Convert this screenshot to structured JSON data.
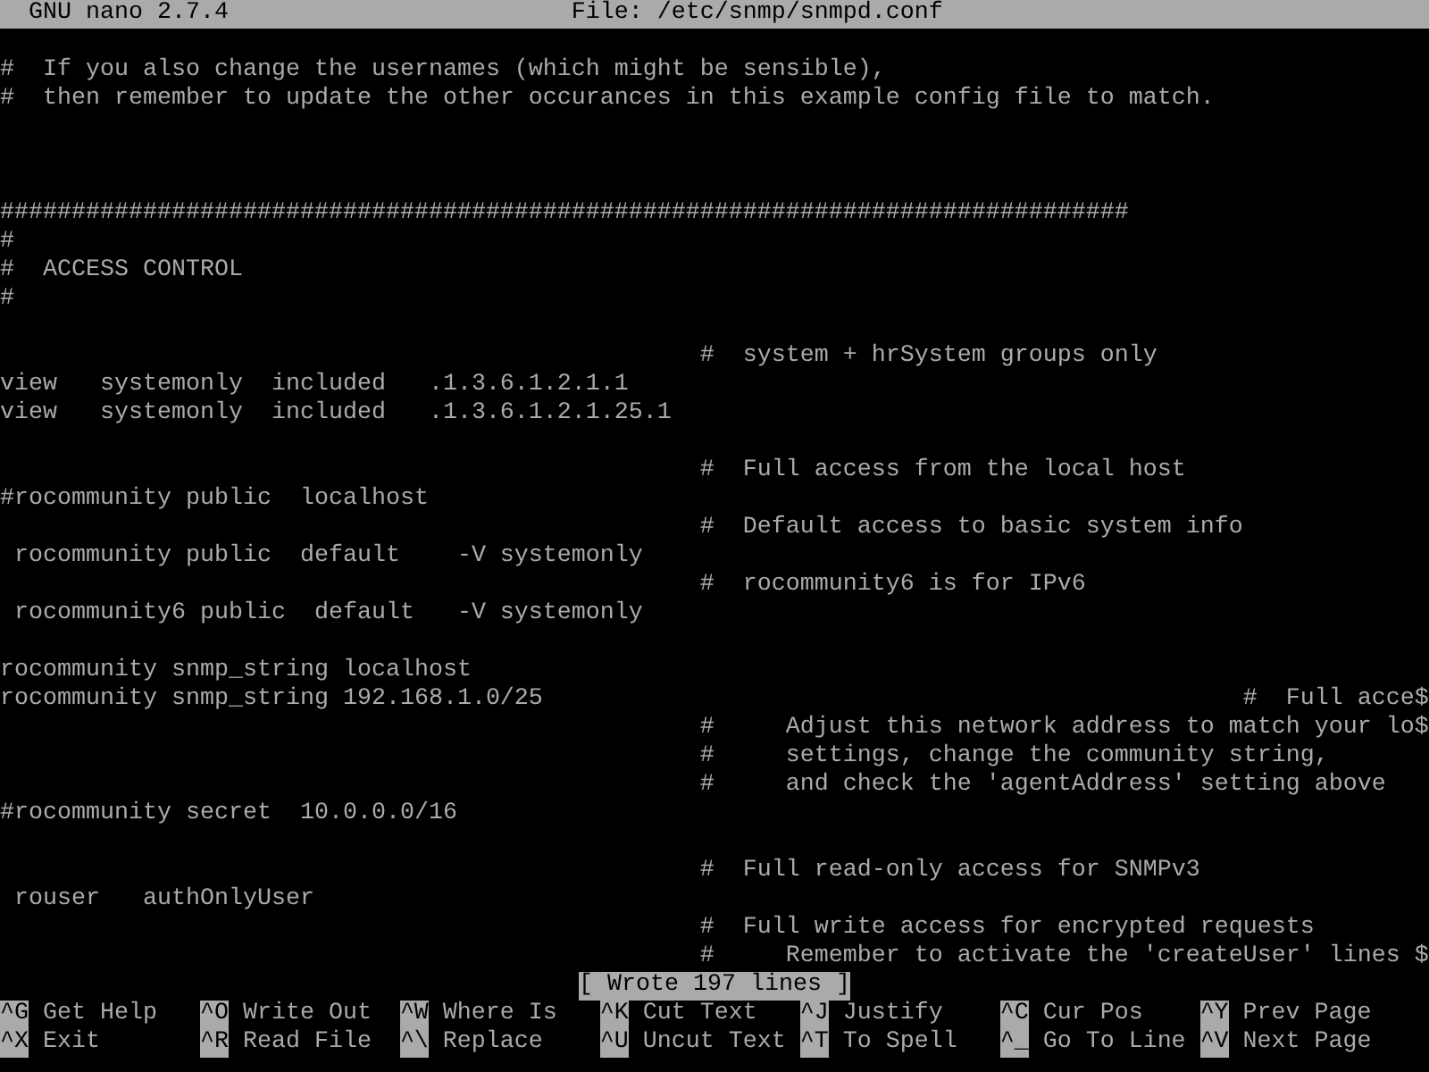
{
  "title_bar": {
    "app": "GNU nano 2.7.4",
    "file": "File: /etc/snmp/snmpd.conf"
  },
  "lines": [
    {
      "kind": "blank"
    },
    {
      "kind": "text",
      "text": "#  If you also change the usernames (which might be sensible),"
    },
    {
      "kind": "text",
      "text": "#  then remember to update the other occurances in this example config file to match."
    },
    {
      "kind": "blank"
    },
    {
      "kind": "blank"
    },
    {
      "kind": "blank"
    },
    {
      "kind": "text",
      "text": "###############################################################################"
    },
    {
      "kind": "text",
      "text": "#"
    },
    {
      "kind": "text",
      "text": "#  ACCESS CONTROL"
    },
    {
      "kind": "text",
      "text": "#"
    },
    {
      "kind": "blank"
    },
    {
      "kind": "text",
      "text": "                                                 #  system + hrSystem groups only"
    },
    {
      "kind": "text",
      "text": "view   systemonly  included   .1.3.6.1.2.1.1"
    },
    {
      "kind": "text",
      "text": "view   systemonly  included   .1.3.6.1.2.1.25.1"
    },
    {
      "kind": "blank"
    },
    {
      "kind": "text",
      "text": "                                                 #  Full access from the local host"
    },
    {
      "kind": "text",
      "text": "#rocommunity public  localhost"
    },
    {
      "kind": "text",
      "text": "                                                 #  Default access to basic system info"
    },
    {
      "kind": "text",
      "text": " rocommunity public  default    -V systemonly"
    },
    {
      "kind": "text",
      "text": "                                                 #  rocommunity6 is for IPv6"
    },
    {
      "kind": "text",
      "text": " rocommunity6 public  default   -V systemonly"
    },
    {
      "kind": "blank"
    },
    {
      "kind": "text",
      "text": "rocommunity snmp_string localhost"
    },
    {
      "kind": "text",
      "text": "rocommunity snmp_string 192.168.1.0/25                                                 #  Full acce$"
    },
    {
      "kind": "text",
      "text": "                                                 #     Adjust this network address to match your lo$"
    },
    {
      "kind": "text",
      "text": "                                                 #     settings, change the community string,"
    },
    {
      "kind": "text",
      "text": "                                                 #     and check the 'agentAddress' setting above"
    },
    {
      "kind": "text",
      "text": "#rocommunity secret  10.0.0.0/16"
    },
    {
      "kind": "blank"
    },
    {
      "kind": "text",
      "text": "                                                 #  Full read-only access for SNMPv3"
    },
    {
      "kind": "text",
      "text": " rouser   authOnlyUser"
    },
    {
      "kind": "text",
      "text": "                                                 #  Full write access for encrypted requests"
    },
    {
      "kind": "text",
      "text": "                                                 #     Remember to activate the 'createUser' lines $"
    }
  ],
  "status": "[ Wrote 197 lines ]",
  "shortcuts": [
    [
      {
        "key": "^G",
        "label": "Get Help"
      },
      {
        "key": "^O",
        "label": "Write Out"
      },
      {
        "key": "^W",
        "label": "Where Is"
      },
      {
        "key": "^K",
        "label": "Cut Text"
      },
      {
        "key": "^J",
        "label": "Justify"
      },
      {
        "key": "^C",
        "label": "Cur Pos"
      },
      {
        "key": "^Y",
        "label": "Prev Page"
      }
    ],
    [
      {
        "key": "^X",
        "label": "Exit"
      },
      {
        "key": "^R",
        "label": "Read File"
      },
      {
        "key": "^\\",
        "label": "Replace"
      },
      {
        "key": "^U",
        "label": "Uncut Text"
      },
      {
        "key": "^T",
        "label": "To Spell"
      },
      {
        "key": "^_",
        "label": "Go To Line"
      },
      {
        "key": "^V",
        "label": "Next Page"
      }
    ]
  ]
}
